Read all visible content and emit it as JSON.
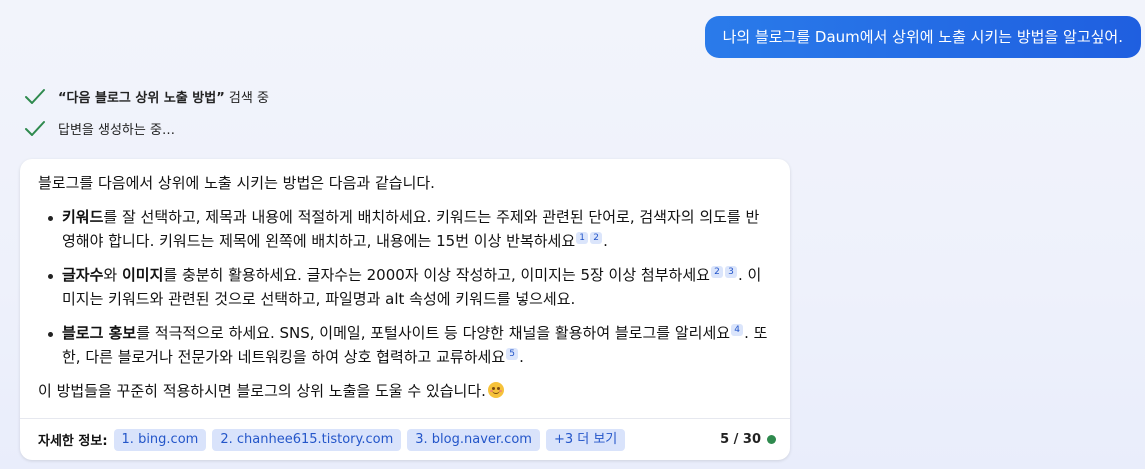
{
  "user_message": "나의 블로그를 Daum에서 상위에 노출 시키는 방법을 알고싶어.",
  "status": {
    "search_query": "“다음 블로그 상위 노출 방법”",
    "search_suffix": " 검색 중",
    "generating": "답변을 생성하는 중…"
  },
  "answer": {
    "intro": "블로그를 다음에서 상위에 노출 시키는 방법은 다음과 같습니다.",
    "point1": {
      "bold": "키워드",
      "text": "를 잘 선택하고, 제목과 내용에 적절하게 배치하세요. 키워드는 주제와 관련된 단어로, 검색자의 의도를 반영해야 합니다. 키워드는 제목에 왼쪽에 배치하고, 내용에는 15번 이상 반복하세요",
      "cites": [
        "1",
        "2"
      ],
      "end": "."
    },
    "point2": {
      "bold1": "글자수",
      "mid": "와 ",
      "bold2": "이미지",
      "text": "를 충분히 활용하세요. 글자수는 2000자 이상 작성하고, 이미지는 5장 이상 첨부하세요",
      "cites": [
        "2",
        "3"
      ],
      "text2": ". 이미지는 키워드와 관련된 것으로 선택하고, 파일명과 alt 속성에 키워드를 넣으세요."
    },
    "point3": {
      "bold": "블로그 홍보",
      "text": "를 적극적으로 하세요. SNS, 이메일, 포털사이트 등 다양한 채널을 활용하여 블로그를 알리세요",
      "cite1": "4",
      "text2": ". 또한, 다른 블로거나 전문가와 네트워킹을 하여 상호 협력하고 교류하세요",
      "cite2": "5",
      "end": "."
    },
    "closing": "이 방법들을 꾸준히 적용하시면 블로그의 상위 노출을 도울 수 있습니다."
  },
  "footer": {
    "label": "자세한 정보:",
    "sources": [
      "1. bing.com",
      "2. chanhee615.tistory.com",
      "3. blog.naver.com"
    ],
    "more": "+3 더 보기",
    "counter": "5 / 30"
  },
  "icons": {
    "status_check": "check-icon",
    "emoji": "smiling-face-emoji",
    "counter_status": "status-dot"
  },
  "colors": {
    "user_bubble": "#1f5fe0",
    "check": "#2f8a4e",
    "chip_bg": "#d9e3fb",
    "chip_text": "#2456c9",
    "status_dot": "#2f8a4e"
  }
}
